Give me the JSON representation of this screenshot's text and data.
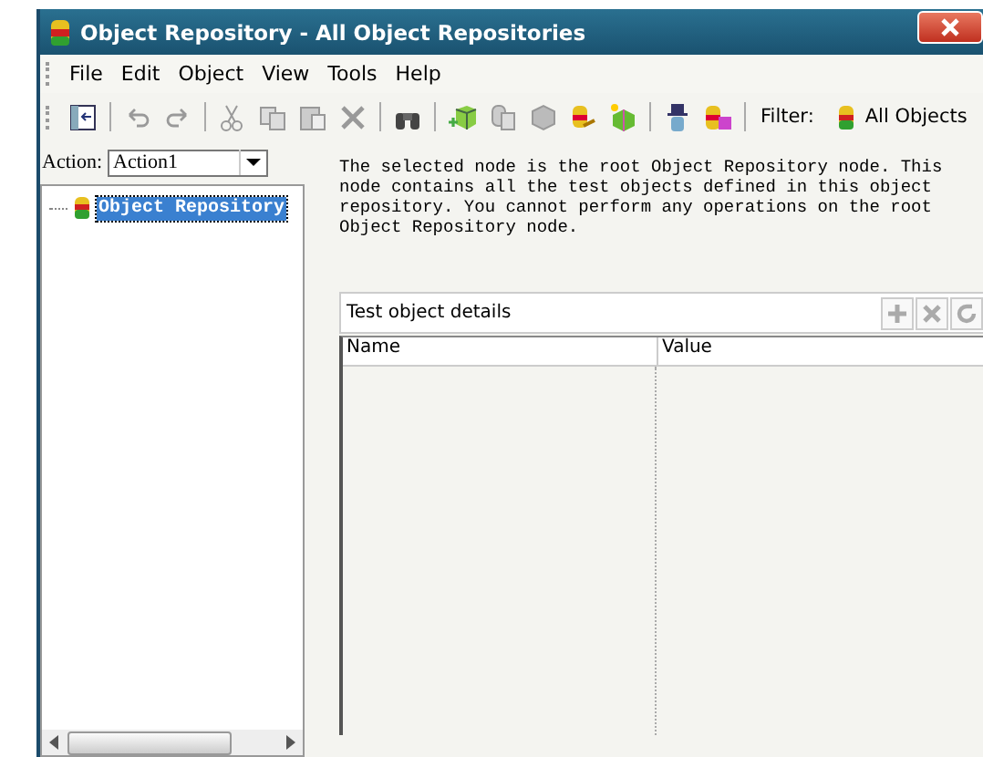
{
  "window": {
    "title": "Object Repository - All Object Repositories"
  },
  "menu": [
    {
      "label": "File"
    },
    {
      "label": "Edit"
    },
    {
      "label": "Object"
    },
    {
      "label": "View"
    },
    {
      "label": "Tools"
    },
    {
      "label": "Help"
    }
  ],
  "toolbar": {
    "filter_label": "Filter:",
    "filter_value": "All Objects"
  },
  "action": {
    "label": "Action:",
    "value": "Action1"
  },
  "tree": [
    {
      "label": "Object Repository",
      "selected": true
    }
  ],
  "description": "The selected node is the root Object Repository node. This node contains all the test objects defined in this object repository. You cannot perform any operations on the root Object Repository node.",
  "details": {
    "title": "Test object details",
    "columns": [
      "Name",
      "Value"
    ]
  }
}
